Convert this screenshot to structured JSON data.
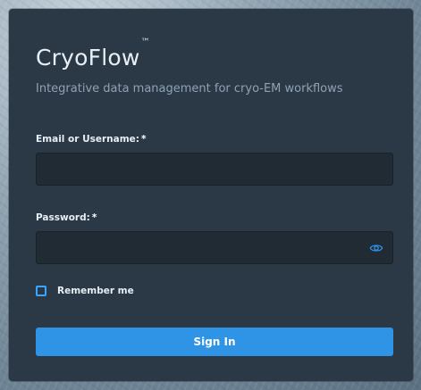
{
  "app": {
    "brand_name": "CryoFlow",
    "brand_tm": "™",
    "tagline": "Integrative data management for cryo-EM workflows"
  },
  "form": {
    "email": {
      "label": "Email or Username:",
      "required_marker": "*",
      "value": "",
      "placeholder": ""
    },
    "password": {
      "label": "Password:",
      "required_marker": "*",
      "value": "",
      "placeholder": ""
    },
    "remember_me": {
      "label": "Remember me",
      "checked": false
    },
    "submit": {
      "label": "Sign In"
    }
  },
  "icons": {
    "password_visibility": "eye-icon"
  },
  "colors": {
    "card_background": "#2b3946",
    "input_background": "#202b34",
    "accent": "#2f93e6",
    "checkbox_border": "#39a6ff",
    "tagline_text": "#8fa2b4",
    "primary_text": "#e7eef5"
  }
}
